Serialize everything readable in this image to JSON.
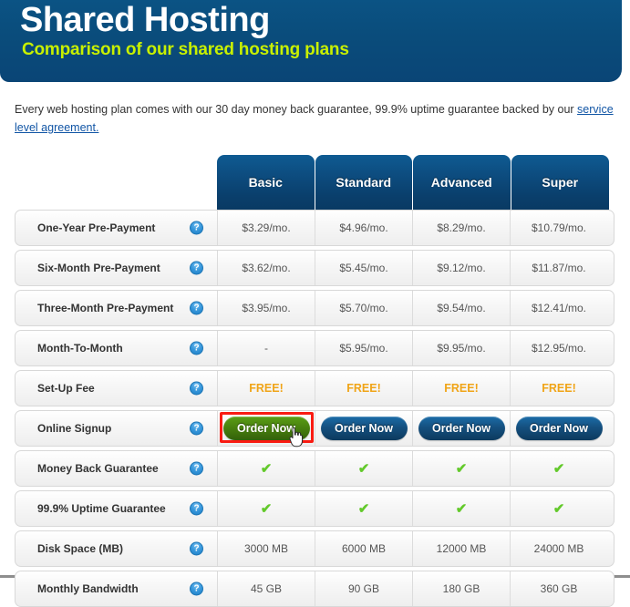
{
  "banner": {
    "title": "Shared Hosting",
    "subtitle": "Comparison of our shared hosting plans",
    "bg_color": "#0a4c7b",
    "title_color": "#ffffff",
    "subtitle_color": "#c8f000"
  },
  "intro": {
    "text_before": "Every web hosting plan comes with our 30 day money back guarantee, 99.9% uptime guarantee backed by our ",
    "link_text": "service level agreement.",
    "link_color": "#1155a5"
  },
  "table": {
    "plans": [
      "Basic",
      "Standard",
      "Advanced",
      "Super"
    ],
    "help_icon": "help-question-icon",
    "help_glyph": "?",
    "check_glyph": "✔",
    "check_color": "#63c92b",
    "free_color": "#f0a417",
    "rows": [
      {
        "label": "One-Year Pre-Payment",
        "type": "text",
        "values": [
          "$3.29/mo.",
          "$4.96/mo.",
          "$8.29/mo.",
          "$10.79/mo."
        ]
      },
      {
        "label": "Six-Month Pre-Payment",
        "type": "text",
        "values": [
          "$3.62/mo.",
          "$5.45/mo.",
          "$9.12/mo.",
          "$11.87/mo."
        ]
      },
      {
        "label": "Three-Month Pre-Payment",
        "type": "text",
        "values": [
          "$3.95/mo.",
          "$5.70/mo.",
          "$9.54/mo.",
          "$12.41/mo."
        ]
      },
      {
        "label": "Month-To-Month",
        "type": "text",
        "values": [
          "-",
          "$5.95/mo.",
          "$9.95/mo.",
          "$12.95/mo."
        ]
      },
      {
        "label": "Set-Up Fee",
        "type": "free",
        "values": [
          "FREE!",
          "FREE!",
          "FREE!",
          "FREE!"
        ]
      },
      {
        "label": "Online Signup",
        "type": "button",
        "values": [
          "Order Now",
          "Order Now",
          "Order Now",
          "Order Now"
        ]
      },
      {
        "label": "Money Back Guarantee",
        "type": "check",
        "values": [
          "✔",
          "✔",
          "✔",
          "✔"
        ]
      },
      {
        "label": "99.9% Uptime Guarantee",
        "type": "check",
        "values": [
          "✔",
          "✔",
          "✔",
          "✔"
        ]
      },
      {
        "label": "Disk Space (MB)",
        "type": "text",
        "values": [
          "3000 MB",
          "6000 MB",
          "12000 MB",
          "24000 MB"
        ]
      },
      {
        "label": "Monthly Bandwidth",
        "type": "text",
        "values": [
          "45 GB",
          "90 GB",
          "180 GB",
          "360 GB"
        ]
      }
    ]
  },
  "interaction": {
    "hovered_button_plan": "Basic",
    "hovered_button_label": "Order Now",
    "highlight_color": "#f91b12",
    "hovered_button_color": "#49820f",
    "cursor": "hand-pointer-cursor"
  }
}
